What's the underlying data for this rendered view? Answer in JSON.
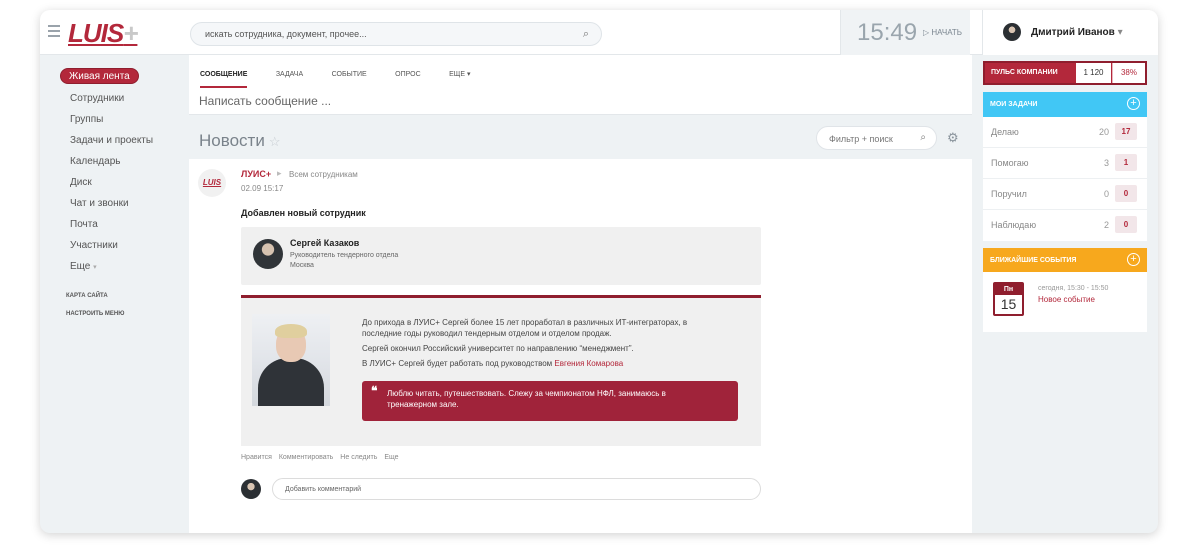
{
  "header": {
    "logo_text": "LUIS",
    "logo_plus": "+",
    "search_placeholder": "искать сотрудника, документ, прочее...",
    "clock": "15:49",
    "start_label": "НАЧАТЬ",
    "user_name": "Дмитрий Иванов"
  },
  "leftnav": {
    "items": [
      "Живая лента",
      "Сотрудники",
      "Группы",
      "Задачи и проекты",
      "Календарь",
      "Диск",
      "Чат и звонки",
      "Почта",
      "Участники",
      "Еще"
    ],
    "small_links": [
      "КАРТА САЙТА",
      "НАСТРОИТЬ МЕНЮ"
    ]
  },
  "composer": {
    "tabs": [
      "СООБЩЕНИЕ",
      "ЗАДАЧА",
      "СОБЫТИЕ",
      "ОПРОС",
      "ЕЩЕ"
    ],
    "placeholder": "Написать сообщение ..."
  },
  "feed": {
    "title": "Новости",
    "filter_placeholder": "Фильтр + поиск"
  },
  "post": {
    "avatar_text": "LUIS",
    "author": "ЛУИС+",
    "audience": "Всем сотрудникам",
    "date": "02.09 15:17",
    "title": "Добавлен новый сотрудник",
    "person_name": "Сергей Казаков",
    "person_role": "Руководитель тендерного отдела",
    "person_city": "Москва",
    "bio_line1": "До прихода в ЛУИС+ Сергей более 15 лет проработал в различных ИТ-интеграторах, в",
    "bio_line2": "последние годы руководил тендерным отделом и отделом продаж.",
    "bio_line3": "Сергей окончил Российский университет по направлению “менеджмент”.",
    "bio_line4_prefix": "В ЛУИС+ Сергей будет работать под руководством ",
    "bio_link": "Евгения Комарова",
    "quote_line1": "Люблю читать, путешествовать. Слежу за чемпионатом НФЛ, занимаюсь в",
    "quote_line2": "тренажерном зале.",
    "actions": [
      "Нравится",
      "Комментировать",
      "Не следить",
      "Еще"
    ],
    "comment_placeholder": "Добавить комментарий"
  },
  "pulse": {
    "label": "ПУЛЬС КОМПАНИИ",
    "count": "1 120",
    "percent": "38%"
  },
  "tasks": {
    "header": "МОИ ЗАДАЧИ",
    "rows": [
      {
        "label": "Делаю",
        "count": "20",
        "badge": "17"
      },
      {
        "label": "Помогаю",
        "count": "3",
        "badge": "1"
      },
      {
        "label": "Поручил",
        "count": "0",
        "badge": "0"
      },
      {
        "label": "Наблюдаю",
        "count": "2",
        "badge": "0"
      }
    ]
  },
  "events": {
    "header": "БЛИЖАЙШИЕ СОБЫТИЯ",
    "cal_weekday": "Пн",
    "cal_day": "15",
    "time": "сегодня, 15:30 - 15:50",
    "title": "Новое событие"
  },
  "colors": {
    "brand": "#b3283b",
    "tasks_header": "#41c7f5",
    "events_header": "#f7a81d"
  }
}
